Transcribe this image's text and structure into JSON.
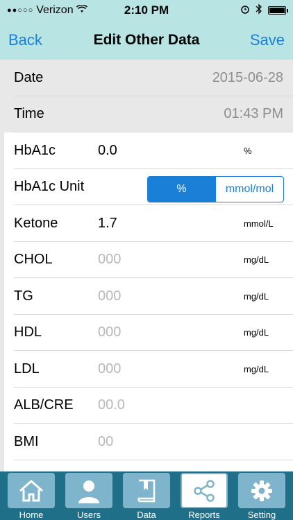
{
  "status": {
    "carrier": "Verizon",
    "time": "2:10 PM"
  },
  "nav": {
    "back_label": "Back",
    "title": "Edit Other Data",
    "save_label": "Save"
  },
  "rows": {
    "date": {
      "label": "Date",
      "value": "2015-06-28"
    },
    "time": {
      "label": "Time",
      "value": "01:43 PM"
    },
    "hba1c": {
      "label": "HbA1c",
      "value": "0.0",
      "unit": "%"
    },
    "hba1c_unit": {
      "label": "HbA1c Unit",
      "options": [
        "%",
        "mmol/mol"
      ],
      "selected": "%"
    },
    "ketone": {
      "label": "Ketone",
      "value": "1.7",
      "unit": "mmol/L"
    },
    "chol": {
      "label": "CHOL",
      "placeholder": "000",
      "unit": "mg/dL"
    },
    "tg": {
      "label": "TG",
      "placeholder": "000",
      "unit": "mg/dL"
    },
    "hdl": {
      "label": "HDL",
      "placeholder": "000",
      "unit": "mg/dL"
    },
    "ldl": {
      "label": "LDL",
      "placeholder": "000",
      "unit": "mg/dL"
    },
    "albcre": {
      "label": "ALB/CRE",
      "placeholder": "00.0"
    },
    "bmi": {
      "label": "BMI",
      "placeholder": "00"
    }
  },
  "tabs": [
    {
      "label": "Home",
      "icon": "home-icon"
    },
    {
      "label": "Users",
      "icon": "user-icon"
    },
    {
      "label": "Data",
      "icon": "book-icon"
    },
    {
      "label": "Reports",
      "icon": "share-icon",
      "active": true
    },
    {
      "label": "Setting",
      "icon": "gear-icon"
    }
  ],
  "colors": {
    "accent": "#1a7fd6",
    "header_bg": "#b8e4e4",
    "tab_bar_bg": "#1e6f87",
    "tab_icon_bg": "#7fb5cc"
  }
}
